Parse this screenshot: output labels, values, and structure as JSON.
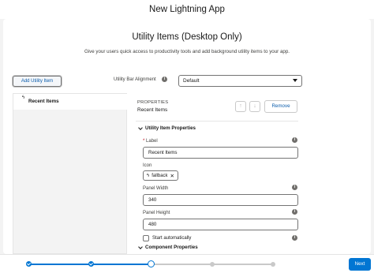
{
  "app": {
    "title": "New Lightning App"
  },
  "page": {
    "title": "Utility Items (Desktop Only)",
    "description": "Give your users quick access to productivity tools and add background utility items to your app."
  },
  "toolbar": {
    "add_label": "Add Utility Item",
    "alignment_label": "Utility Bar Alignment",
    "alignment_value": "Default"
  },
  "items": [
    {
      "label": "Recent Items",
      "icon": "lightning-bolt-icon"
    }
  ],
  "properties": {
    "kicker": "PROPERTIES",
    "name": "Recent Items",
    "remove_label": "Remove",
    "section_title": "Utility Item Properties",
    "label_field": {
      "required_mark": "*",
      "label": "Label",
      "value": "Recent Items"
    },
    "icon_field": {
      "label": "Icon",
      "value": "fallback"
    },
    "width_field": {
      "label": "Panel Width",
      "value": "340"
    },
    "height_field": {
      "label": "Panel Height",
      "value": "480"
    },
    "start_auto": {
      "label": "Start automatically",
      "checked": false
    },
    "component_section_title": "Component Properties"
  },
  "footer": {
    "next_label": "Next",
    "steps_total": 5,
    "current_step": 3
  },
  "colors": {
    "brand": "#0176d3",
    "text": "#181818",
    "background": "#f3f3f3"
  }
}
